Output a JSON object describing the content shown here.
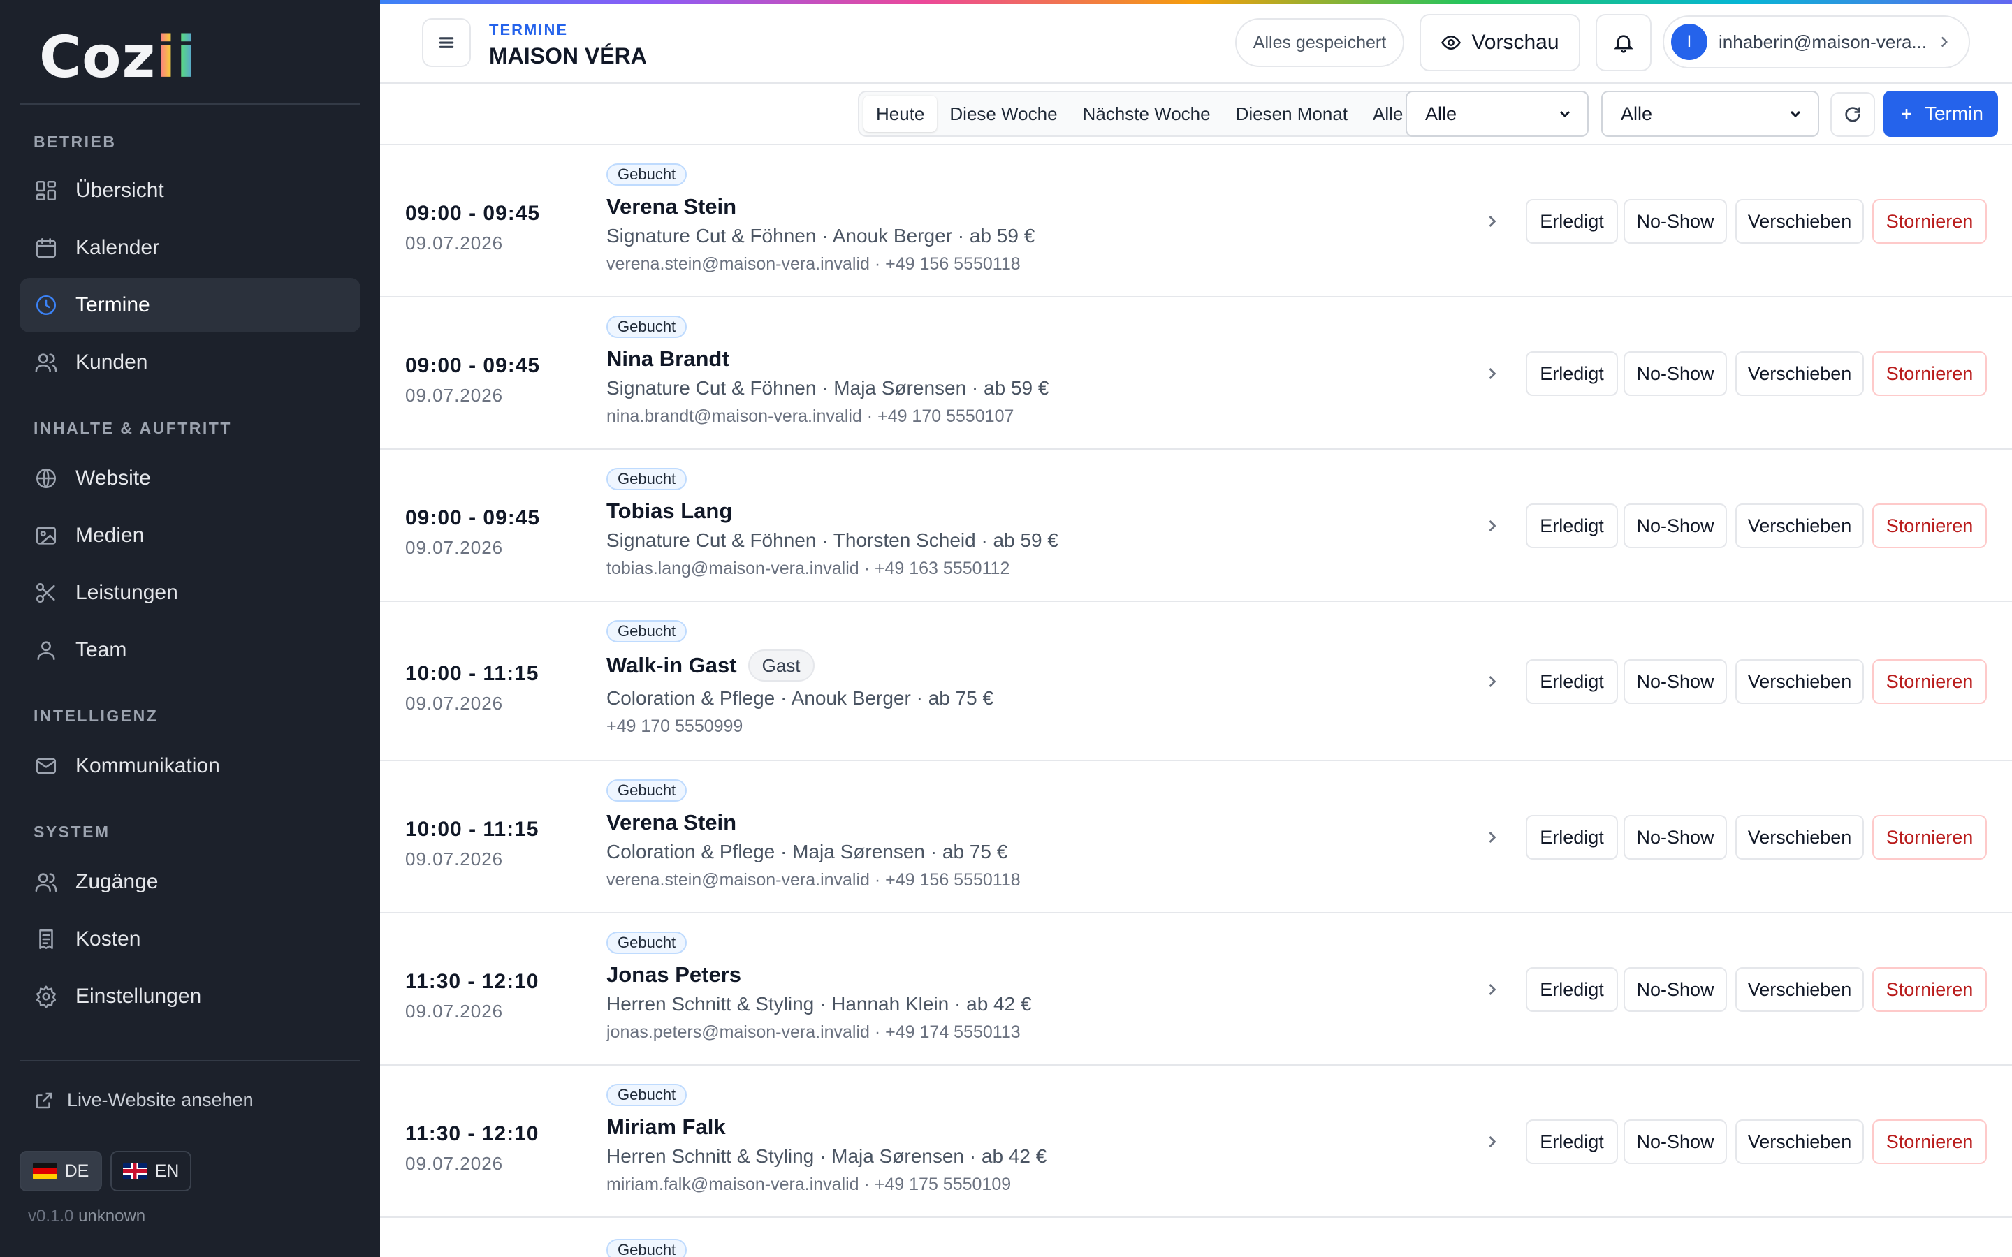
{
  "app": {
    "logo_text_a": "Coz",
    "logo_text_b": "ii"
  },
  "sidebar": {
    "sections": {
      "betrieb": "BETRIEB",
      "inhalte": "INHALTE & AUFTRITT",
      "intelligenz": "INTELLIGENZ",
      "system": "SYSTEM"
    },
    "items": {
      "uebersicht": "Übersicht",
      "kalender": "Kalender",
      "termine": "Termine",
      "kunden": "Kunden",
      "website": "Website",
      "medien": "Medien",
      "leistungen": "Leistungen",
      "team": "Team",
      "kommunikation": "Kommunikation",
      "zugaenge": "Zugänge",
      "kosten": "Kosten",
      "einstellungen": "Einstellungen"
    },
    "live_link": "Live-Website ansehen",
    "languages": [
      {
        "code": "DE",
        "active": true
      },
      {
        "code": "EN",
        "active": false
      }
    ],
    "version": "v0.1.0",
    "version_suffix": "unknown"
  },
  "header": {
    "breadcrumb": "TERMINE",
    "studio_name": "MAISON VÉRA",
    "save_status": "Alles gespeichert",
    "preview_label": "Vorschau",
    "user_avatar_initial": "I",
    "user_email": "inhaberin@maison-vera...."
  },
  "filters": {
    "ranges": [
      "Heute",
      "Diese Woche",
      "Nächste Woche",
      "Diesen Monat",
      "Alle"
    ],
    "active_range": "Heute",
    "select_one": "Alle",
    "select_two": "Alle",
    "new_label": "Termin"
  },
  "actions": {
    "done": "Erledigt",
    "noshow": "No-Show",
    "move": "Verschieben",
    "cancel": "Stornieren"
  },
  "colors": {
    "accent": "#2563eb",
    "sidebar_bg": "#1c212b",
    "cancel_text": "#b91c1c"
  },
  "appointments": [
    {
      "time": "09:00 - 09:45",
      "date": "09.07.2026",
      "status": "Gebucht",
      "name": "Verena Stein",
      "guest_tag": "",
      "service": "Signature Cut & Föhnen · Anouk Berger · ab 59 €",
      "contact": "verena.stein@maison-vera.invalid · +49 156 5550118"
    },
    {
      "time": "09:00 - 09:45",
      "date": "09.07.2026",
      "status": "Gebucht",
      "name": "Nina Brandt",
      "guest_tag": "",
      "service": "Signature Cut & Föhnen · Maja Sørensen · ab 59 €",
      "contact": "nina.brandt@maison-vera.invalid · +49 170 5550107"
    },
    {
      "time": "09:00 - 09:45",
      "date": "09.07.2026",
      "status": "Gebucht",
      "name": "Tobias Lang",
      "guest_tag": "",
      "service": "Signature Cut & Föhnen · Thorsten Scheid · ab 59 €",
      "contact": "tobias.lang@maison-vera.invalid · +49 163 5550112"
    },
    {
      "time": "10:00 - 11:15",
      "date": "09.07.2026",
      "status": "Gebucht",
      "name": "Walk-in Gast",
      "guest_tag": "Gast",
      "service": "Coloration & Pflege · Anouk Berger · ab 75 €",
      "contact": "+49 170 5550999"
    },
    {
      "time": "10:00 - 11:15",
      "date": "09.07.2026",
      "status": "Gebucht",
      "name": "Verena Stein",
      "guest_tag": "",
      "service": "Coloration & Pflege · Maja Sørensen · ab 75 €",
      "contact": "verena.stein@maison-vera.invalid · +49 156 5550118"
    },
    {
      "time": "11:30 - 12:10",
      "date": "09.07.2026",
      "status": "Gebucht",
      "name": "Jonas Peters",
      "guest_tag": "",
      "service": "Herren Schnitt & Styling · Hannah Klein · ab 42 €",
      "contact": "jonas.peters@maison-vera.invalid · +49 174 5550113"
    },
    {
      "time": "11:30 - 12:10",
      "date": "09.07.2026",
      "status": "Gebucht",
      "name": "Miriam Falk",
      "guest_tag": "",
      "service": "Herren Schnitt & Styling · Maja Sørensen · ab 42 €",
      "contact": "miriam.falk@maison-vera.invalid · +49 175 5550109"
    },
    {
      "time": "",
      "date": "",
      "status": "Gebucht",
      "name": "",
      "guest_tag": "",
      "service": "",
      "contact": ""
    }
  ]
}
